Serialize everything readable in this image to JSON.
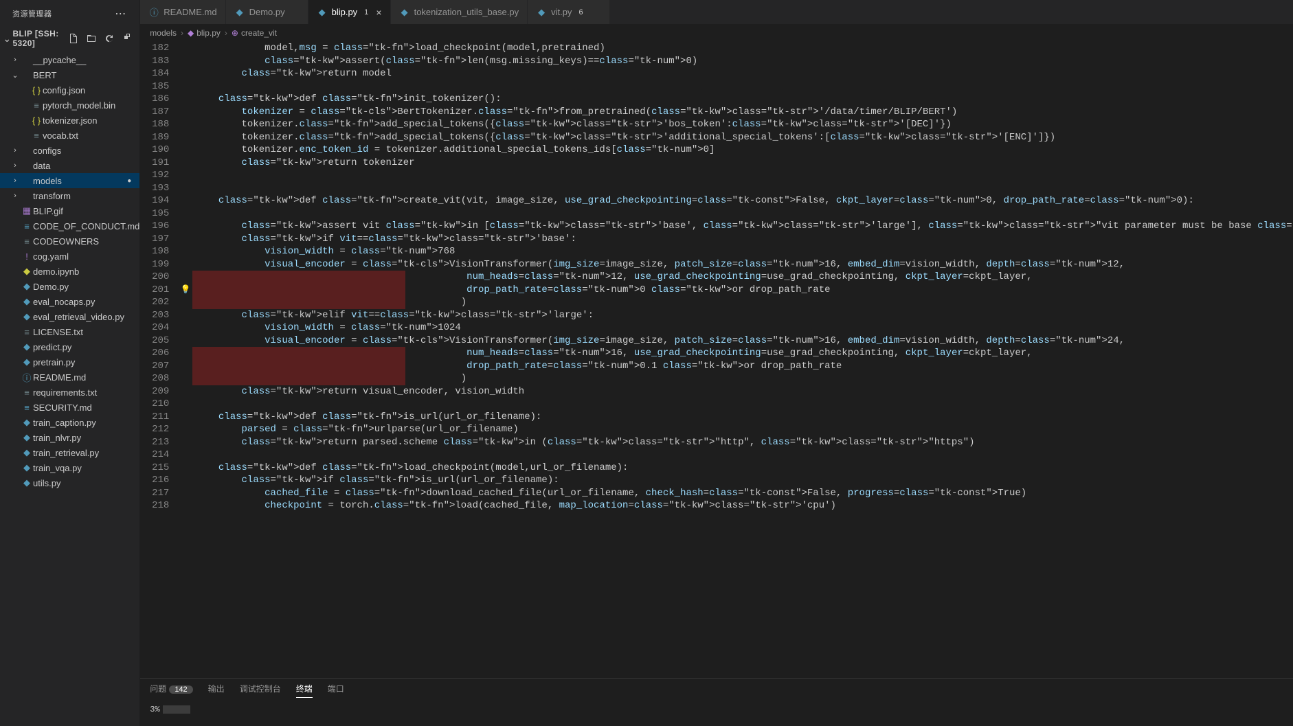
{
  "sidebar": {
    "title": "资源管理器",
    "project": "BLIP [SSH: 5320]",
    "actions": [
      "new-file",
      "new-folder",
      "refresh",
      "collapse"
    ],
    "tree": [
      {
        "type": "folder",
        "label": "__pycache__",
        "depth": 1,
        "open": false
      },
      {
        "type": "folder",
        "label": "BERT",
        "depth": 1,
        "open": true
      },
      {
        "type": "file",
        "label": "config.json",
        "depth": 2,
        "icon": "json"
      },
      {
        "type": "file",
        "label": "pytorch_model.bin",
        "depth": 2,
        "icon": "bin"
      },
      {
        "type": "file",
        "label": "tokenizer.json",
        "depth": 2,
        "icon": "json"
      },
      {
        "type": "file",
        "label": "vocab.txt",
        "depth": 2,
        "icon": "txt"
      },
      {
        "type": "folder",
        "label": "configs",
        "depth": 1,
        "open": false
      },
      {
        "type": "folder",
        "label": "data",
        "depth": 1,
        "open": false
      },
      {
        "type": "folder",
        "label": "models",
        "depth": 1,
        "open": false,
        "selected": true,
        "dirty": true
      },
      {
        "type": "folder",
        "label": "transform",
        "depth": 1,
        "open": false
      },
      {
        "type": "file",
        "label": "BLIP.gif",
        "depth": 1,
        "icon": "gif"
      },
      {
        "type": "file",
        "label": "CODE_OF_CONDUCT.md",
        "depth": 1,
        "icon": "md"
      },
      {
        "type": "file",
        "label": "CODEOWNERS",
        "depth": 1,
        "icon": "txt"
      },
      {
        "type": "file",
        "label": "cog.yaml",
        "depth": 1,
        "icon": "yaml"
      },
      {
        "type": "file",
        "label": "demo.ipynb",
        "depth": 1,
        "icon": "nb"
      },
      {
        "type": "file",
        "label": "Demo.py",
        "depth": 1,
        "icon": "py"
      },
      {
        "type": "file",
        "label": "eval_nocaps.py",
        "depth": 1,
        "icon": "py"
      },
      {
        "type": "file",
        "label": "eval_retrieval_video.py",
        "depth": 1,
        "icon": "py"
      },
      {
        "type": "file",
        "label": "LICENSE.txt",
        "depth": 1,
        "icon": "txt"
      },
      {
        "type": "file",
        "label": "predict.py",
        "depth": 1,
        "icon": "py"
      },
      {
        "type": "file",
        "label": "pretrain.py",
        "depth": 1,
        "icon": "py"
      },
      {
        "type": "file",
        "label": "README.md",
        "depth": 1,
        "icon": "info"
      },
      {
        "type": "file",
        "label": "requirements.txt",
        "depth": 1,
        "icon": "txt"
      },
      {
        "type": "file",
        "label": "SECURITY.md",
        "depth": 1,
        "icon": "md"
      },
      {
        "type": "file",
        "label": "train_caption.py",
        "depth": 1,
        "icon": "py"
      },
      {
        "type": "file",
        "label": "train_nlvr.py",
        "depth": 1,
        "icon": "py"
      },
      {
        "type": "file",
        "label": "train_retrieval.py",
        "depth": 1,
        "icon": "py"
      },
      {
        "type": "file",
        "label": "train_vqa.py",
        "depth": 1,
        "icon": "py"
      },
      {
        "type": "file",
        "label": "utils.py",
        "depth": 1,
        "icon": "py"
      }
    ]
  },
  "tabs": [
    {
      "label": "README.md",
      "icon": "info",
      "active": false
    },
    {
      "label": "Demo.py",
      "icon": "py",
      "active": false
    },
    {
      "label": "blip.py",
      "icon": "py",
      "active": true,
      "badge": "1",
      "modified": true,
      "close": true
    },
    {
      "label": "tokenization_utils_base.py",
      "icon": "py",
      "active": false
    },
    {
      "label": "vit.py",
      "icon": "py",
      "active": false,
      "badge": "6"
    }
  ],
  "breadcrumb": [
    {
      "label": "models"
    },
    {
      "label": "blip.py",
      "icon": "py"
    },
    {
      "label": "create_vit",
      "icon": "fn"
    }
  ],
  "editor": {
    "first_line": 182,
    "bulb_line": 201,
    "error_ranges": [
      [
        200,
        202
      ],
      [
        206,
        208
      ]
    ],
    "lines": [
      "            model,msg = load_checkpoint(model,pretrained)",
      "            assert(len(msg.missing_keys)==0)",
      "        return model",
      "",
      "    def init_tokenizer():",
      "        tokenizer = BertTokenizer.from_pretrained('/data/timer/BLIP/BERT')",
      "        tokenizer.add_special_tokens({'bos_token':'[DEC]'})",
      "        tokenizer.add_special_tokens({'additional_special_tokens':['[ENC]']})",
      "        tokenizer.enc_token_id = tokenizer.additional_special_tokens_ids[0]",
      "        return tokenizer",
      "",
      "",
      "    def create_vit(vit, image_size, use_grad_checkpointing=False, ckpt_layer=0, drop_path_rate=0):",
      "",
      "        assert vit in ['base', 'large'], \"vit parameter must be base or large\"",
      "        if vit=='base':",
      "            vision_width = 768",
      "            visual_encoder = VisionTransformer(img_size=image_size, patch_size=16, embed_dim=vision_width, depth=12,",
      "                                               num_heads=12, use_grad_checkpointing=use_grad_checkpointing, ckpt_layer=ckpt_layer,",
      "                                               drop_path_rate=0 or drop_path_rate",
      "                                              )",
      "        elif vit=='large':",
      "            vision_width = 1024",
      "            visual_encoder = VisionTransformer(img_size=image_size, patch_size=16, embed_dim=vision_width, depth=24,",
      "                                               num_heads=16, use_grad_checkpointing=use_grad_checkpointing, ckpt_layer=ckpt_layer,",
      "                                               drop_path_rate=0.1 or drop_path_rate",
      "                                              )",
      "        return visual_encoder, vision_width",
      "",
      "    def is_url(url_or_filename):",
      "        parsed = urlparse(url_or_filename)",
      "        return parsed.scheme in (\"http\", \"https\")",
      "",
      "    def load_checkpoint(model,url_or_filename):",
      "        if is_url(url_or_filename):",
      "            cached_file = download_cached_file(url_or_filename, check_hash=False, progress=True)",
      "            checkpoint = torch.load(cached_file, map_location='cpu')"
    ]
  },
  "panel": {
    "tabs": [
      {
        "label": "问题",
        "badge": "142"
      },
      {
        "label": "输出"
      },
      {
        "label": "调试控制台"
      },
      {
        "label": "终端",
        "active": true
      },
      {
        "label": "端口"
      }
    ],
    "progress_label": "3%",
    "progress_pct": 3
  }
}
